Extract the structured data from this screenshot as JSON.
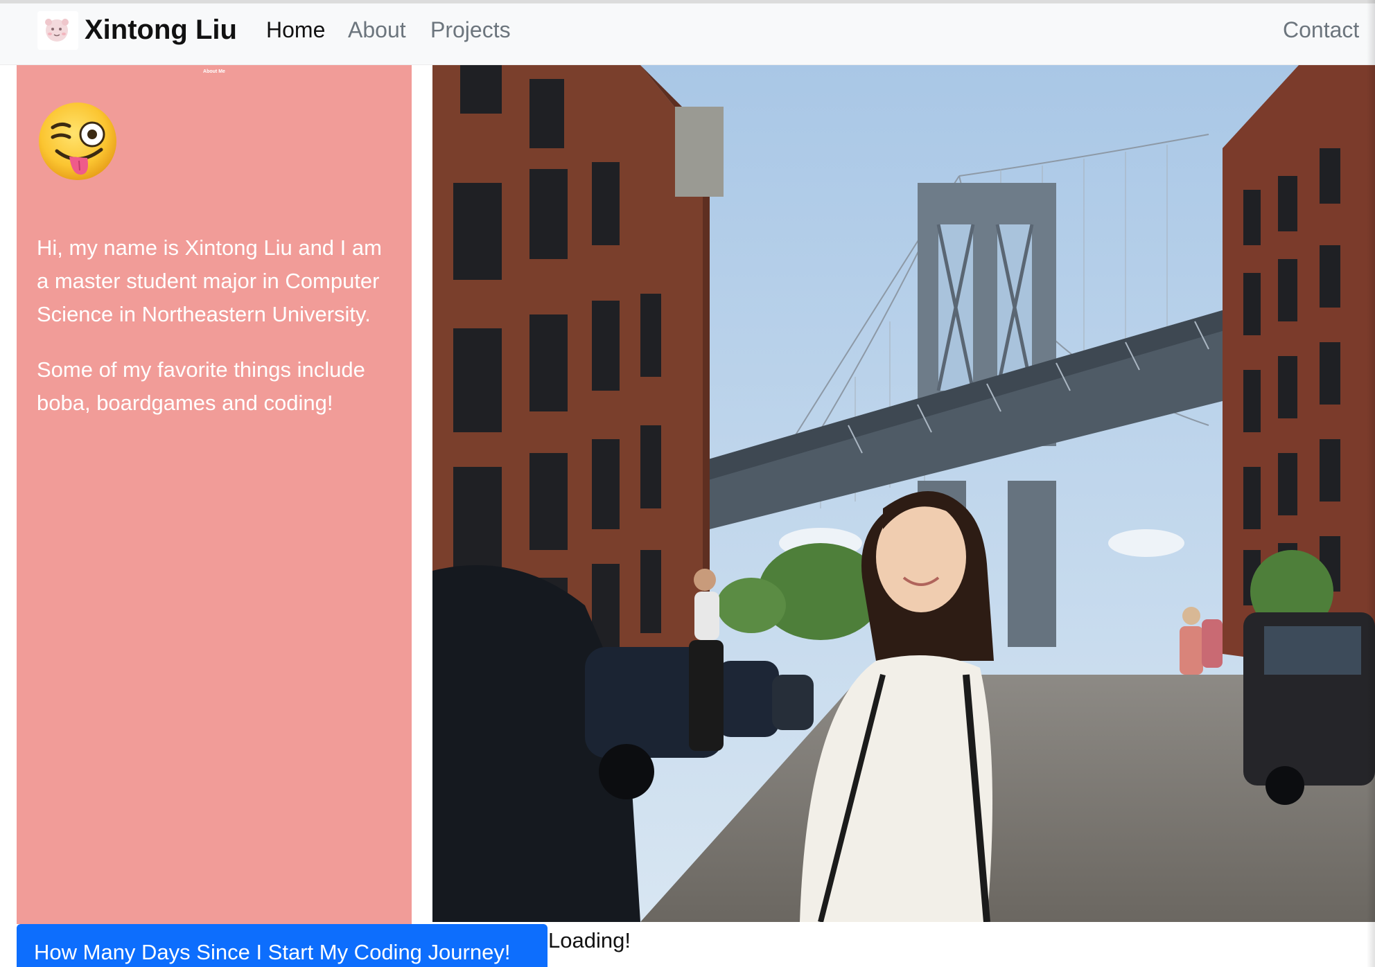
{
  "navbar": {
    "brand_name": "Xintong Liu",
    "links": [
      {
        "label": "Home",
        "active": true
      },
      {
        "label": "About",
        "active": false
      },
      {
        "label": "Projects",
        "active": false
      }
    ],
    "contact_label": "Contact"
  },
  "about": {
    "title": "About Me",
    "emoji": "winking-face-with-tongue",
    "paragraphs": [
      "Hi, my name is Xintong Liu and I am a master student major in Computer Science in Northeastern University.",
      "Some of my favorite things include boba, boardgames and coding!"
    ]
  },
  "photo": {
    "subject": "photo-brooklyn-bridge-street"
  },
  "footer": {
    "counter_button_label": "How Many Days Since I Start My Coding Journey!",
    "loading_text": "Loading!"
  },
  "colors": {
    "navbar_bg": "#f8f9fa",
    "about_card_bg": "#f19c98",
    "button_bg": "#0d6efd",
    "text_dark": "#111111",
    "nav_muted": "#6c757d"
  }
}
